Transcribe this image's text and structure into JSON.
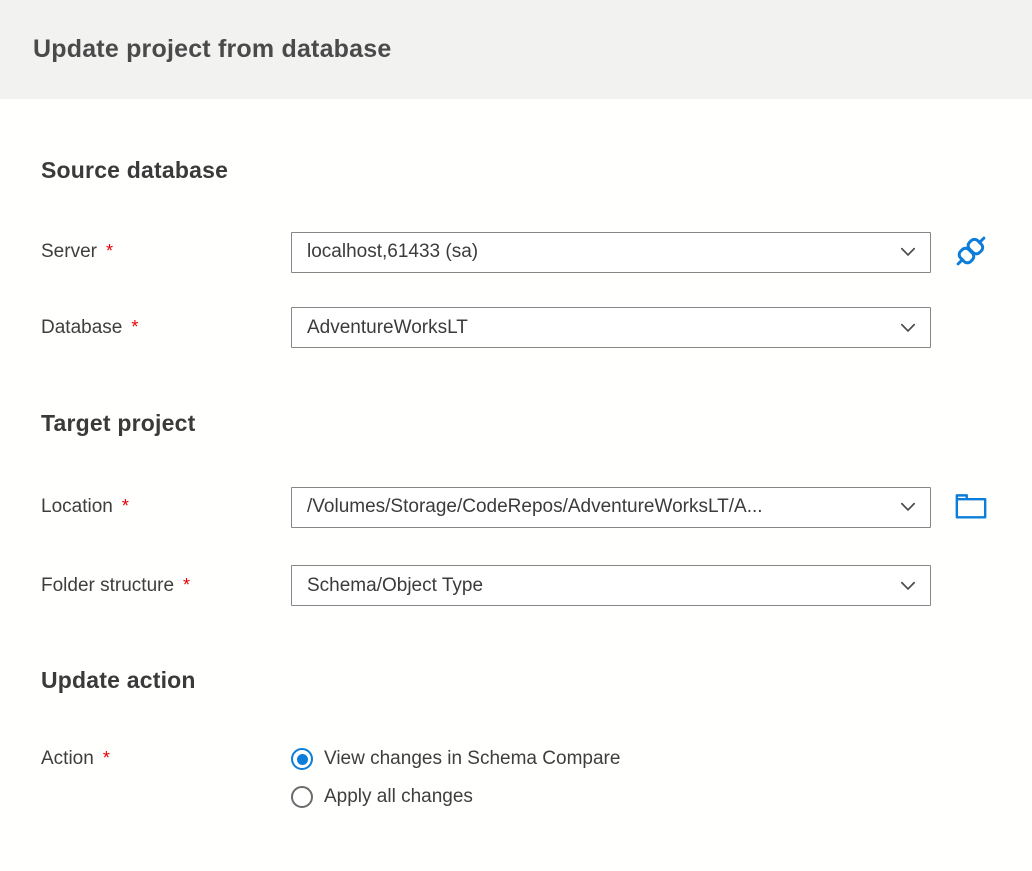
{
  "header": {
    "title": "Update project from database"
  },
  "colors": {
    "accent": "#0c7dd9",
    "required": "#e80000",
    "header-bg": "#f2f2f1",
    "page-bg": "#fffffe",
    "heading-text": "#3a3a3a",
    "label-text": "#3e3e3e",
    "value-text": "#3b3b3b",
    "control-border": "#878787",
    "chevron": "#4c4c4c",
    "radio-border": "#6b6b6b"
  },
  "required_marker": "*",
  "sections": {
    "source_database": {
      "title": "Source database",
      "fields": {
        "server": {
          "label": "Server",
          "value": "localhost,61433 (sa)",
          "icon": "plug-icon"
        },
        "database": {
          "label": "Database",
          "value": "AdventureWorksLT",
          "icon": "chevron-down-icon"
        }
      }
    },
    "target_project": {
      "title": "Target project",
      "fields": {
        "location": {
          "label": "Location",
          "value": "/Volumes/Storage/CodeRepos/AdventureWorksLT/A...",
          "icon": "folder-icon"
        },
        "folder_structure": {
          "label": "Folder structure",
          "value": "Schema/Object Type",
          "icon": "chevron-down-icon"
        }
      }
    },
    "update_action": {
      "title": "Update action",
      "fields": {
        "action": {
          "label": "Action",
          "options": {
            "view_changes": {
              "label": "View changes in Schema Compare",
              "selected": true
            },
            "apply_all": {
              "label": "Apply all changes",
              "selected": false
            }
          }
        }
      }
    }
  }
}
